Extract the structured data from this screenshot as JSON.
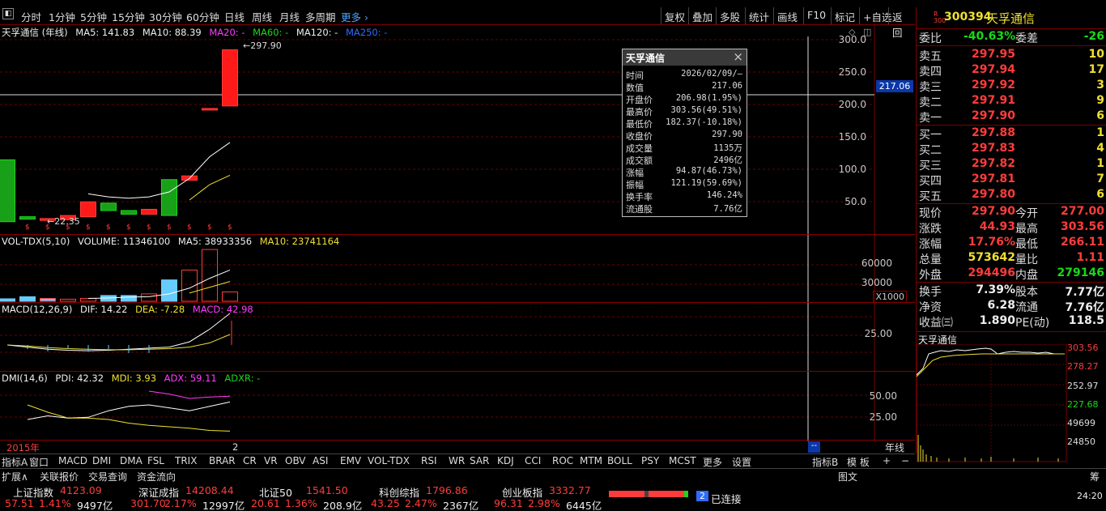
{
  "colors": {
    "up": "#ff3c3c",
    "down": "#19d919",
    "bg": "#000000",
    "accent": "#2e6bff"
  },
  "menu_icon": "menu-icon",
  "period_tabs": [
    "分时",
    "1分钟",
    "5分钟",
    "15分钟",
    "30分钟",
    "60分钟",
    "日线",
    "周线",
    "月线",
    "多周期",
    "更多"
  ],
  "active_period": "年线",
  "right_toolbar": [
    "复权",
    "叠加",
    "多股",
    "统计",
    "画线",
    "F10",
    "标记",
    "+自选",
    "返回"
  ],
  "stock": {
    "title": "天孚通信 (年线)",
    "code": "300394",
    "name": "天孚通信",
    "badge_r": "R",
    "badge_300": "300"
  },
  "ma": {
    "ma5": "MA5: 141.83",
    "ma10": "MA10: 88.39",
    "ma20": "MA20: -",
    "ma60": "MA60: -",
    "ma120": "MA120: -",
    "ma250": "MA250: -"
  },
  "price_axis": [
    "300.0",
    "250.0",
    "200.0",
    "150.0",
    "100.0",
    "50.0"
  ],
  "price_tag": "217.06",
  "high_label": "297.90",
  "low_label": "22.35",
  "volume": {
    "title": "VOL-TDX(5,10)",
    "volume": "VOLUME: 11346100",
    "ma5": "MA5: 38933356",
    "ma10": "MA10: 23741164",
    "axis": [
      "60000",
      "30000"
    ],
    "unit": "X1000"
  },
  "macd": {
    "title": "MACD(12,26,9)",
    "dif": "DIF: 14.22",
    "dea": "DEA: -7.28",
    "macd": "MACD: 42.98",
    "axis": [
      "25.00"
    ]
  },
  "dmi": {
    "title": "DMI(14,6)",
    "pdi": "PDI: 42.32",
    "mdi": "MDI: 3.93",
    "adx": "ADX: 59.11",
    "adxr": "ADXR: -",
    "axis": [
      "50.00",
      "25.00"
    ]
  },
  "x_label_start": "2015年",
  "x_label_end": "2",
  "cursor_tag": "--",
  "period_label": "年线",
  "chart_data": {
    "type": "candlestick",
    "x": [
      "2015",
      "2016",
      "2017",
      "2018",
      "2019",
      "2020",
      "2021",
      "2022",
      "2023",
      "2024",
      "2025",
      "2026"
    ],
    "open": [
      120,
      28,
      22,
      23,
      28,
      50,
      38,
      32,
      88,
      87,
      203,
      207
    ],
    "close": [
      20,
      24,
      25,
      30,
      52,
      38,
      32,
      40,
      30,
      94,
      203,
      297.9
    ],
    "volume": [
      3000,
      5500,
      3500,
      2500,
      3500,
      7000,
      7000,
      9000,
      26000,
      38000,
      63000,
      11346
    ],
    "ylim": [
      0,
      320
    ]
  },
  "tooltip": {
    "title": "天孚通信",
    "rows": [
      {
        "k": "时间",
        "v": "2026/02/09/—",
        "c": "white"
      },
      {
        "k": "数值",
        "v": "217.06",
        "c": "white"
      },
      {
        "k": "开盘价",
        "v": "206.98(1.95%)",
        "c": "red"
      },
      {
        "k": "最高价",
        "v": "303.56(49.51%)",
        "c": "red"
      },
      {
        "k": "最低价",
        "v": "182.37(-10.18%)",
        "c": "green"
      },
      {
        "k": "收盘价",
        "v": "297.90",
        "c": "red"
      },
      {
        "k": "成交量",
        "v": "1135万",
        "c": "white"
      },
      {
        "k": "成交额",
        "v": "2496亿",
        "c": "white"
      },
      {
        "k": "涨幅",
        "v": "94.87(46.73%)",
        "c": "red"
      },
      {
        "k": "振幅",
        "v": "121.19(59.69%)",
        "c": "white"
      },
      {
        "k": "换手率",
        "v": "146.24%",
        "c": "white"
      },
      {
        "k": "流通股",
        "v": "7.76亿",
        "c": "white"
      }
    ]
  },
  "indicator_tabs": [
    "指标A",
    "窗口",
    "MACD",
    "DMI",
    "DMA",
    "FSL",
    "TRIX",
    "BRAR",
    "CR",
    "VR",
    "OBV",
    "ASI",
    "EMV",
    "VOL-TDX",
    "RSI",
    "WR",
    "SAR",
    "KDJ",
    "CCI",
    "ROC",
    "MTM",
    "BOLL",
    "PSY",
    "MCST",
    "更多",
    "设置"
  ],
  "indicator_right": [
    "指标B",
    "模 板",
    "+",
    "−"
  ],
  "bottom_tabs": [
    "扩展∧",
    "关联报价",
    "交易查询",
    "资金流向"
  ],
  "bottom_right": [
    "图文",
    "筹"
  ],
  "order_book": {
    "weibi_l": "委比",
    "weibi": "-40.63%",
    "weicha_l": "委差",
    "weicha": "-26",
    "sell": [
      {
        "l": "卖五",
        "p": "297.95",
        "q": "10"
      },
      {
        "l": "卖四",
        "p": "297.94",
        "q": "17"
      },
      {
        "l": "卖三",
        "p": "297.92",
        "q": "3"
      },
      {
        "l": "卖二",
        "p": "297.91",
        "q": "9"
      },
      {
        "l": "卖一",
        "p": "297.90",
        "q": "6"
      }
    ],
    "buy": [
      {
        "l": "买一",
        "p": "297.88",
        "q": "1"
      },
      {
        "l": "买二",
        "p": "297.83",
        "q": "4"
      },
      {
        "l": "买三",
        "p": "297.82",
        "q": "1"
      },
      {
        "l": "买四",
        "p": "297.81",
        "q": "7"
      },
      {
        "l": "买五",
        "p": "297.80",
        "q": "6"
      }
    ]
  },
  "quote": [
    {
      "l": "现价",
      "v": "297.90",
      "vc": "red",
      "l2": "今开",
      "v2": "277.00",
      "v2c": "red"
    },
    {
      "l": "涨跌",
      "v": "44.93",
      "vc": "red",
      "l2": "最高",
      "v2": "303.56",
      "v2c": "red"
    },
    {
      "l": "涨幅",
      "v": "17.76%",
      "vc": "red",
      "l2": "最低",
      "v2": "266.11",
      "v2c": "red"
    },
    {
      "l": "总量",
      "v": "573642",
      "vc": "yellow",
      "l2": "量比",
      "v2": "1.11",
      "v2c": "red"
    },
    {
      "l": "外盘",
      "v": "294496",
      "vc": "red",
      "l2": "内盘",
      "v2": "279146",
      "v2c": "green"
    },
    {
      "l": "换手",
      "v": "7.39%",
      "vc": "white",
      "l2": "股本",
      "v2": "7.77亿",
      "v2c": "white"
    },
    {
      "l": "净资",
      "v": "6.28",
      "vc": "white",
      "l2": "流通",
      "v2": "7.76亿",
      "v2c": "white"
    },
    {
      "l": "收益㈢",
      "v": "1.890",
      "vc": "white",
      "l2": "PE(动)",
      "v2": "118.5",
      "v2c": "white"
    }
  ],
  "mini": {
    "title": "天孚通信",
    "p1": "303.56",
    "p2": "278.27",
    "p3": "252.97",
    "p4": "227.68",
    "v1": "49699",
    "v2": "24850",
    "time": "24:20"
  },
  "indices": [
    {
      "name": "上证指数",
      "val": "4123.09",
      "chg": "57.51",
      "pct": "1.41%",
      "amt": "9497亿"
    },
    {
      "name": "深证成指",
      "val": "14208.44",
      "chg": "301.70",
      "pct": "2.17%",
      "amt": "12997亿"
    },
    {
      "name": "北证50",
      "val": "1541.50",
      "chg": "20.61",
      "pct": "1.36%",
      "amt": "208.9亿"
    },
    {
      "name": "科创综指",
      "val": "1796.86",
      "chg": "43.25",
      "pct": "2.47%",
      "amt": "2367亿"
    },
    {
      "name": "创业板指",
      "val": "3332.77",
      "chg": "96.31",
      "pct": "2.98%",
      "amt": "6445亿"
    }
  ],
  "connection": {
    "count": "2",
    "label": "已连接"
  }
}
